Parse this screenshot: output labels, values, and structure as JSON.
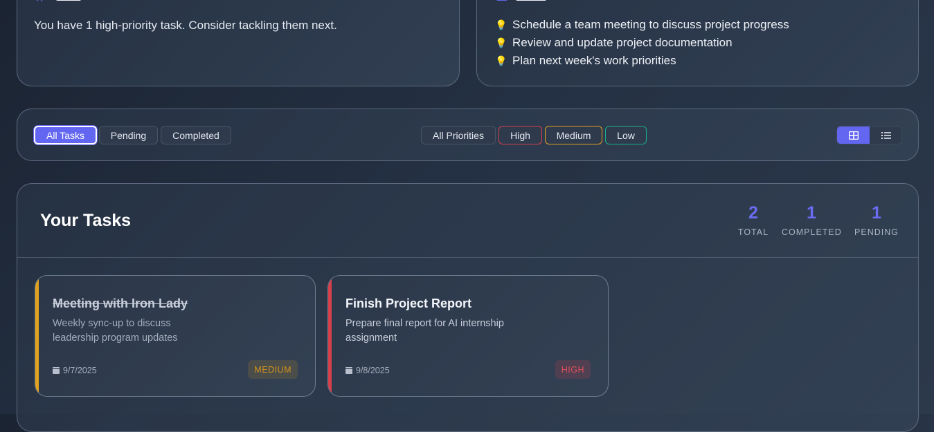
{
  "insight": {
    "text": "You have 1 high-priority task. Consider tackling them next."
  },
  "suggestions": {
    "items": [
      "Schedule a team meeting to discuss project progress",
      "Review and update project documentation",
      "Plan next week's work priorities"
    ],
    "item_icon": "lightbulb-icon"
  },
  "filters": {
    "status": [
      "All Tasks",
      "Pending",
      "Completed"
    ],
    "status_selected": "All Tasks",
    "priority": [
      "All Priorities",
      "High",
      "Medium",
      "Low"
    ],
    "priority_colors": {
      "high": "#d6404b",
      "medium": "#e0a21f",
      "low": "#19b08a"
    },
    "view_modes": [
      "grid-view-icon",
      "list-view-icon"
    ],
    "view_selected": "grid-view-icon",
    "accent": "#6366f1"
  },
  "tasks": {
    "title": "Your Tasks",
    "stats": [
      {
        "value": "2",
        "label": "TOTAL"
      },
      {
        "value": "1",
        "label": "COMPLETED"
      },
      {
        "value": "1",
        "label": "PENDING"
      }
    ],
    "items": [
      {
        "title": "Meeting with Iron Lady",
        "description": "Weekly sync-up to discuss leadership program updates",
        "date": "9/7/2025",
        "priority": "MEDIUM",
        "completed": true,
        "stripe_color": "#e0a21f"
      },
      {
        "title": "Finish Project Report",
        "description": "Prepare final report for AI internship assignment",
        "date": "9/8/2025",
        "priority": "HIGH",
        "completed": false,
        "stripe_color": "#d6404b"
      }
    ]
  }
}
